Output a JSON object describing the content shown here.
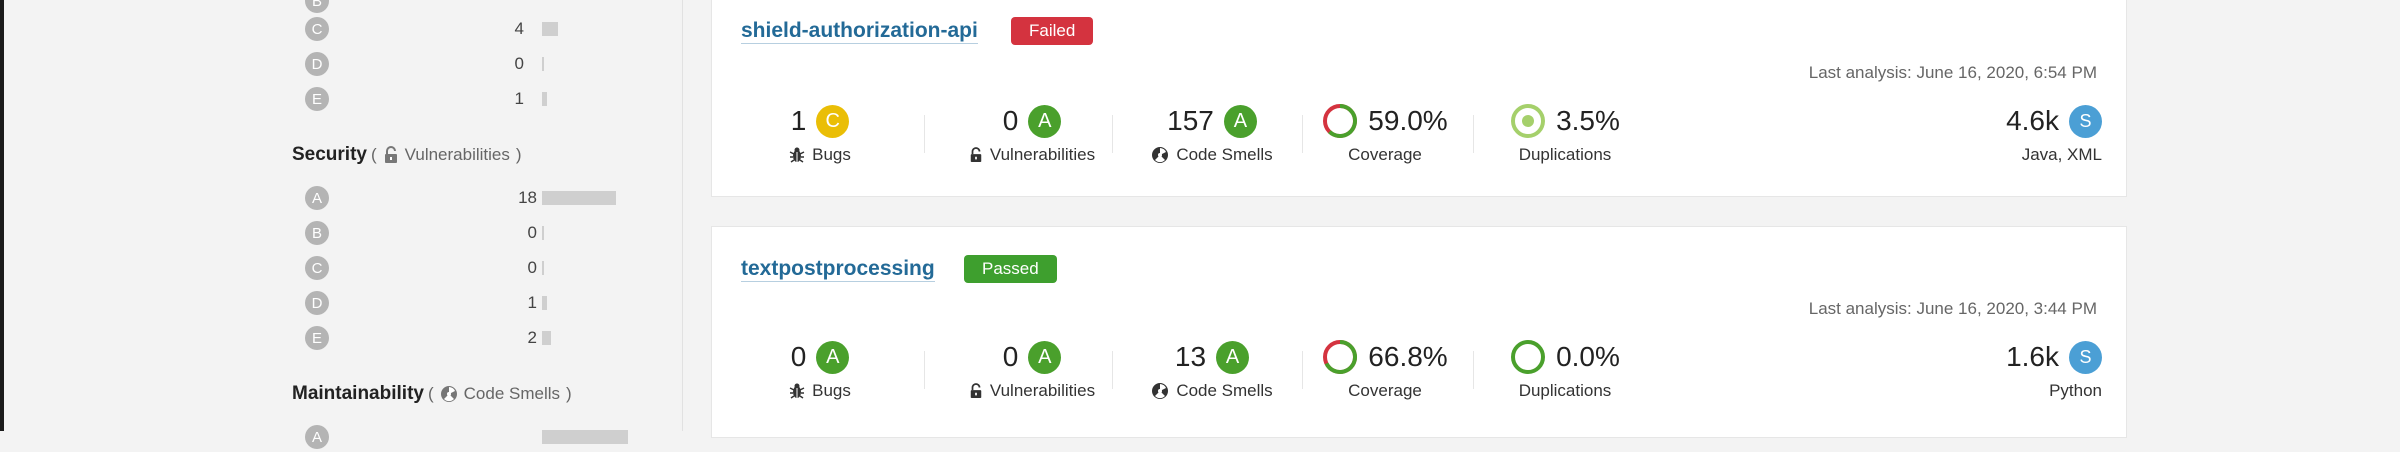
{
  "sidebar": {
    "reliability_rows": [
      {
        "grade": "C",
        "count": "4"
      },
      {
        "grade": "D",
        "count": "0"
      },
      {
        "grade": "E",
        "count": "1"
      }
    ],
    "security": {
      "title": "Security",
      "paren_open": "(",
      "subtitle": "Vulnerabilities",
      "paren_close": ")",
      "rows": [
        {
          "grade": "A",
          "count": "18"
        },
        {
          "grade": "B",
          "count": "0"
        },
        {
          "grade": "C",
          "count": "0"
        },
        {
          "grade": "D",
          "count": "1"
        },
        {
          "grade": "E",
          "count": "2"
        }
      ]
    },
    "maintainability": {
      "title": "Maintainability",
      "paren_open": "(",
      "subtitle": "Code Smells",
      "paren_close": ")"
    }
  },
  "projects": [
    {
      "name": "shield-authorization-api",
      "status": "Failed",
      "last_analysis": "Last analysis: June 16, 2020, 6:54 PM",
      "bugs": {
        "value": "1",
        "rating": "C",
        "label": "Bugs"
      },
      "vulnerabilities": {
        "value": "0",
        "rating": "A",
        "label": "Vulnerabilities"
      },
      "code_smells": {
        "value": "157",
        "rating": "A",
        "label": "Code Smells"
      },
      "coverage": {
        "value": "59.0%",
        "label": "Coverage",
        "percent": 59.0
      },
      "duplications": {
        "value": "3.5%",
        "label": "Duplications",
        "percent": 3.5
      },
      "size": {
        "value": "4.6k",
        "badge": "S",
        "languages": "Java, XML"
      }
    },
    {
      "name": "textpostprocessing",
      "status": "Passed",
      "last_analysis": "Last analysis: June 16, 2020, 3:44 PM",
      "bugs": {
        "value": "0",
        "rating": "A",
        "label": "Bugs"
      },
      "vulnerabilities": {
        "value": "0",
        "rating": "A",
        "label": "Vulnerabilities"
      },
      "code_smells": {
        "value": "13",
        "rating": "A",
        "label": "Code Smells"
      },
      "coverage": {
        "value": "66.8%",
        "label": "Coverage",
        "percent": 66.8
      },
      "duplications": {
        "value": "0.0%",
        "label": "Duplications",
        "percent": 0.0
      },
      "size": {
        "value": "1.6k",
        "badge": "S",
        "languages": "Python"
      }
    }
  ],
  "colors": {
    "rating_a": "#4aa02c",
    "rating_c": "#eabe06",
    "failed": "#d4333f",
    "passed": "#3e9f2e",
    "link": "#236a97",
    "coverage_good": "#4aa02c",
    "coverage_bad": "#d4333f",
    "size_badge": "#4b9fd5"
  },
  "icons": {
    "bug": "bug-icon",
    "lock": "lock-icon",
    "code_smell": "code-smell-icon"
  }
}
